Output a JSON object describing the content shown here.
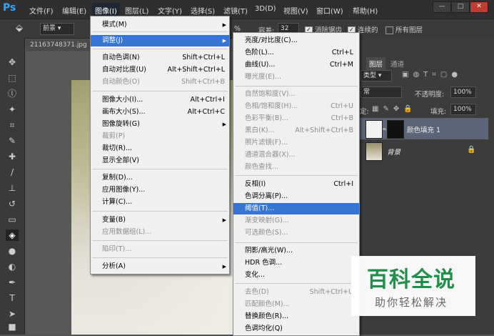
{
  "app": {
    "logo": "Ps"
  },
  "menubar": [
    "文件(F)",
    "编辑(E)",
    "图像(I)",
    "图层(L)",
    "文字(Y)",
    "选择(S)",
    "滤镜(T)",
    "3D(D)",
    "视图(V)",
    "窗口(W)",
    "帮助(H)"
  ],
  "window_buttons": [
    "—",
    "□",
    "✕"
  ],
  "options": {
    "source": "前景",
    "mode_frag": "%",
    "tolerance_label": "容差:",
    "tolerance": "32",
    "antialias": "消除锯齿",
    "contiguous": "连续的",
    "all_layers": "所有图层"
  },
  "document": {
    "tab": "21163748371.jpg"
  },
  "image_menu": [
    {
      "label": "模式(M)",
      "shortcut": "",
      "arrow": true,
      "disabled": false
    },
    {
      "label": "调整(J)",
      "shortcut": "",
      "arrow": true,
      "disabled": false,
      "highlight": true
    },
    {
      "label": "自动色调(N)",
      "shortcut": "Shift+Ctrl+L",
      "disabled": false
    },
    {
      "label": "自动对比度(U)",
      "shortcut": "Alt+Shift+Ctrl+L",
      "disabled": false
    },
    {
      "label": "自动颜色(O)",
      "shortcut": "Shift+Ctrl+B",
      "disabled": true
    },
    {
      "label": "图像大小(I)...",
      "shortcut": "Alt+Ctrl+I",
      "disabled": false
    },
    {
      "label": "画布大小(S)...",
      "shortcut": "Alt+Ctrl+C",
      "disabled": false
    },
    {
      "label": "图像旋转(G)",
      "shortcut": "",
      "arrow": true,
      "disabled": false
    },
    {
      "label": "裁剪(P)",
      "shortcut": "",
      "disabled": true
    },
    {
      "label": "裁切(R)...",
      "shortcut": "",
      "disabled": false
    },
    {
      "label": "显示全部(V)",
      "shortcut": "",
      "disabled": false
    },
    {
      "label": "复制(D)...",
      "shortcut": "",
      "disabled": false
    },
    {
      "label": "应用图像(Y)...",
      "shortcut": "",
      "disabled": false
    },
    {
      "label": "计算(C)...",
      "shortcut": "",
      "disabled": false
    },
    {
      "label": "变量(B)",
      "shortcut": "",
      "arrow": true,
      "disabled": false
    },
    {
      "label": "应用数据组(L)...",
      "shortcut": "",
      "disabled": true
    },
    {
      "label": "陷印(T)...",
      "shortcut": "",
      "disabled": true
    },
    {
      "label": "分析(A)",
      "shortcut": "",
      "arrow": true,
      "disabled": false
    }
  ],
  "adjust_menu": [
    {
      "label": "亮度/对比度(C)...",
      "shortcut": "",
      "disabled": false
    },
    {
      "label": "色阶(L)...",
      "shortcut": "Ctrl+L",
      "disabled": false
    },
    {
      "label": "曲线(U)...",
      "shortcut": "Ctrl+M",
      "disabled": false
    },
    {
      "label": "曝光度(E)...",
      "shortcut": "",
      "disabled": true
    },
    {
      "label": "自然饱和度(V)...",
      "shortcut": "",
      "disabled": true
    },
    {
      "label": "色相/饱和度(H)...",
      "shortcut": "Ctrl+U",
      "disabled": true
    },
    {
      "label": "色彩平衡(B)...",
      "shortcut": "Ctrl+B",
      "disabled": true
    },
    {
      "label": "黑白(K)...",
      "shortcut": "Alt+Shift+Ctrl+B",
      "disabled": true
    },
    {
      "label": "照片滤镜(F)...",
      "shortcut": "",
      "disabled": true
    },
    {
      "label": "通道混合器(X)...",
      "shortcut": "",
      "disabled": true
    },
    {
      "label": "颜色查找...",
      "shortcut": "",
      "disabled": true
    },
    {
      "label": "反相(I)",
      "shortcut": "Ctrl+I",
      "disabled": false
    },
    {
      "label": "色调分离(P)...",
      "shortcut": "",
      "disabled": false
    },
    {
      "label": "阈值(T)...",
      "shortcut": "",
      "disabled": false,
      "highlight": true
    },
    {
      "label": "渐变映射(G)...",
      "shortcut": "",
      "disabled": true
    },
    {
      "label": "可选颜色(S)...",
      "shortcut": "",
      "disabled": true
    },
    {
      "label": "阴影/高光(W)...",
      "shortcut": "",
      "disabled": false
    },
    {
      "label": "HDR 色调...",
      "shortcut": "",
      "disabled": false
    },
    {
      "label": "变化...",
      "shortcut": "",
      "disabled": false
    },
    {
      "label": "去色(D)",
      "shortcut": "Shift+Ctrl+U",
      "disabled": true
    },
    {
      "label": "匹配颜色(M)...",
      "shortcut": "",
      "disabled": true
    },
    {
      "label": "替换颜色(R)...",
      "shortcut": "",
      "disabled": false
    },
    {
      "label": "色调均化(Q)",
      "shortcut": "",
      "disabled": false
    }
  ],
  "panels": {
    "tabs": [
      "图层",
      "通道"
    ],
    "kind": "类型",
    "blend": "常",
    "opacity_label": "不透明度:",
    "opacity": "100%",
    "lock_label": "定:",
    "fill_label": "填充:",
    "fill": "100%",
    "layers": [
      "颜色填充 1",
      "背景"
    ]
  },
  "watermark": {
    "title": "百科全说",
    "subtitle": "助你轻松解决"
  }
}
